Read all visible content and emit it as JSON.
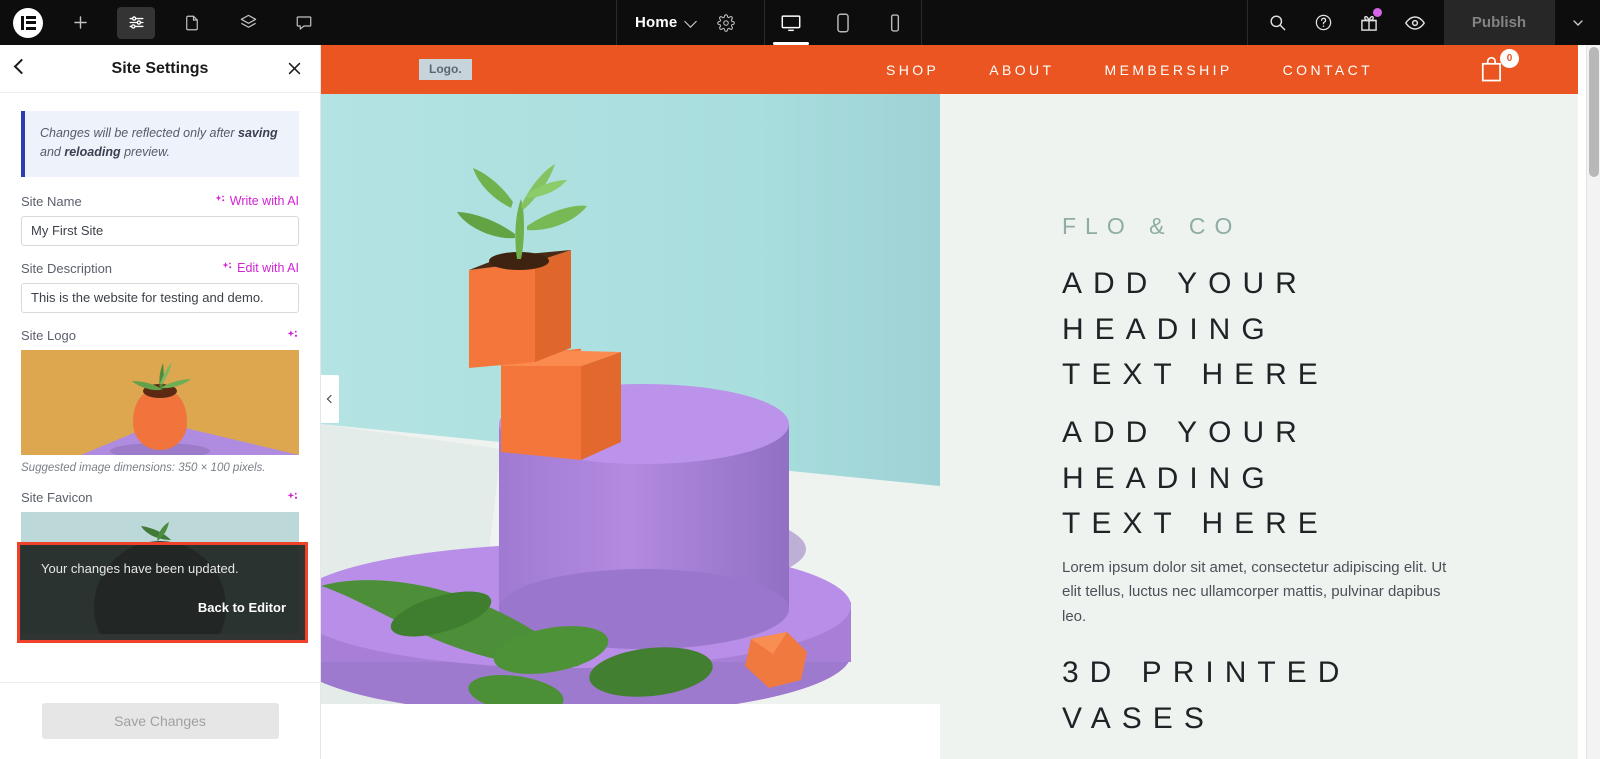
{
  "topbar": {
    "logo_name": "elementor-logo",
    "icons": [
      {
        "name": "add-element-icon",
        "glyph": "plus"
      },
      {
        "name": "site-settings-icon",
        "glyph": "sliders",
        "active": true
      },
      {
        "name": "page-settings-icon",
        "glyph": "document"
      },
      {
        "name": "navigator-icon",
        "glyph": "layers"
      },
      {
        "name": "history-icon",
        "glyph": "comment"
      }
    ],
    "page_label": "Home",
    "page_settings_icon": "gear-icon",
    "devices": [
      {
        "name": "device-desktop",
        "selected": true
      },
      {
        "name": "device-tablet",
        "selected": false
      },
      {
        "name": "device-mobile",
        "selected": false
      }
    ],
    "right_icons": [
      {
        "name": "search-icon"
      },
      {
        "name": "help-icon"
      },
      {
        "name": "gift-icon",
        "has_dot": true
      },
      {
        "name": "preview-icon"
      }
    ],
    "publish_label": "Publish",
    "publish_disabled": true,
    "publish_caret_icon": "chevron-down-icon"
  },
  "sidebar": {
    "back_icon": "back-chevron-icon",
    "title": "Site Settings",
    "close_icon": "close-icon",
    "notice": {
      "prefix": "Changes will be reflected only after ",
      "bold1": "saving",
      "mid": " and ",
      "bold2": "reloading",
      "suffix": " preview."
    },
    "site_name": {
      "label": "Site Name",
      "ai_label": "Write with AI",
      "value": "My First Site",
      "placeholder": "Site Name"
    },
    "site_description": {
      "label": "Site Description",
      "ai_label": "Edit with AI",
      "value": "This is the website for testing and demo.",
      "placeholder": "Site Description"
    },
    "site_logo": {
      "label": "Site Logo",
      "ai_icon": "sparkle-icon",
      "hint": "Suggested image dimensions: 350 × 100 pixels."
    },
    "site_favicon": {
      "label": "Site Favicon",
      "ai_icon": "sparkle-icon"
    },
    "toast": {
      "message": "Your changes have been updated.",
      "action": "Back to Editor",
      "highlight_color": "#f0422a"
    },
    "save_label": "Save Changes",
    "save_disabled": true
  },
  "preview": {
    "collapse_icon": "collapse-chevron-icon",
    "site_header": {
      "logo_text": "Logo.",
      "background": "#eb5521",
      "nav": [
        {
          "label": "SHOP"
        },
        {
          "label": "ABOUT"
        },
        {
          "label": "MEMBERSHIP"
        },
        {
          "label": "CONTACT"
        }
      ],
      "cart_icon": "shopping-bag-icon",
      "cart_count": "0"
    },
    "hero": {
      "eyebrow": "FLO & CO",
      "eyebrow_color": "#8fada4",
      "heading_1": "ADD YOUR\nHEADING\nTEXT HERE",
      "heading_2": "ADD YOUR\nHEADING\nTEXT HERE",
      "body": "Lorem ipsum dolor sit amet, consectetur adipiscing elit. Ut elit tellus, luctus nec ullamcorper mattis, pulvinar dapibus leo.",
      "heading_3": "3D PRINTED\nVASES",
      "background": "#eef3f0"
    }
  },
  "scrollbar": {
    "name": "page-scrollbar"
  }
}
